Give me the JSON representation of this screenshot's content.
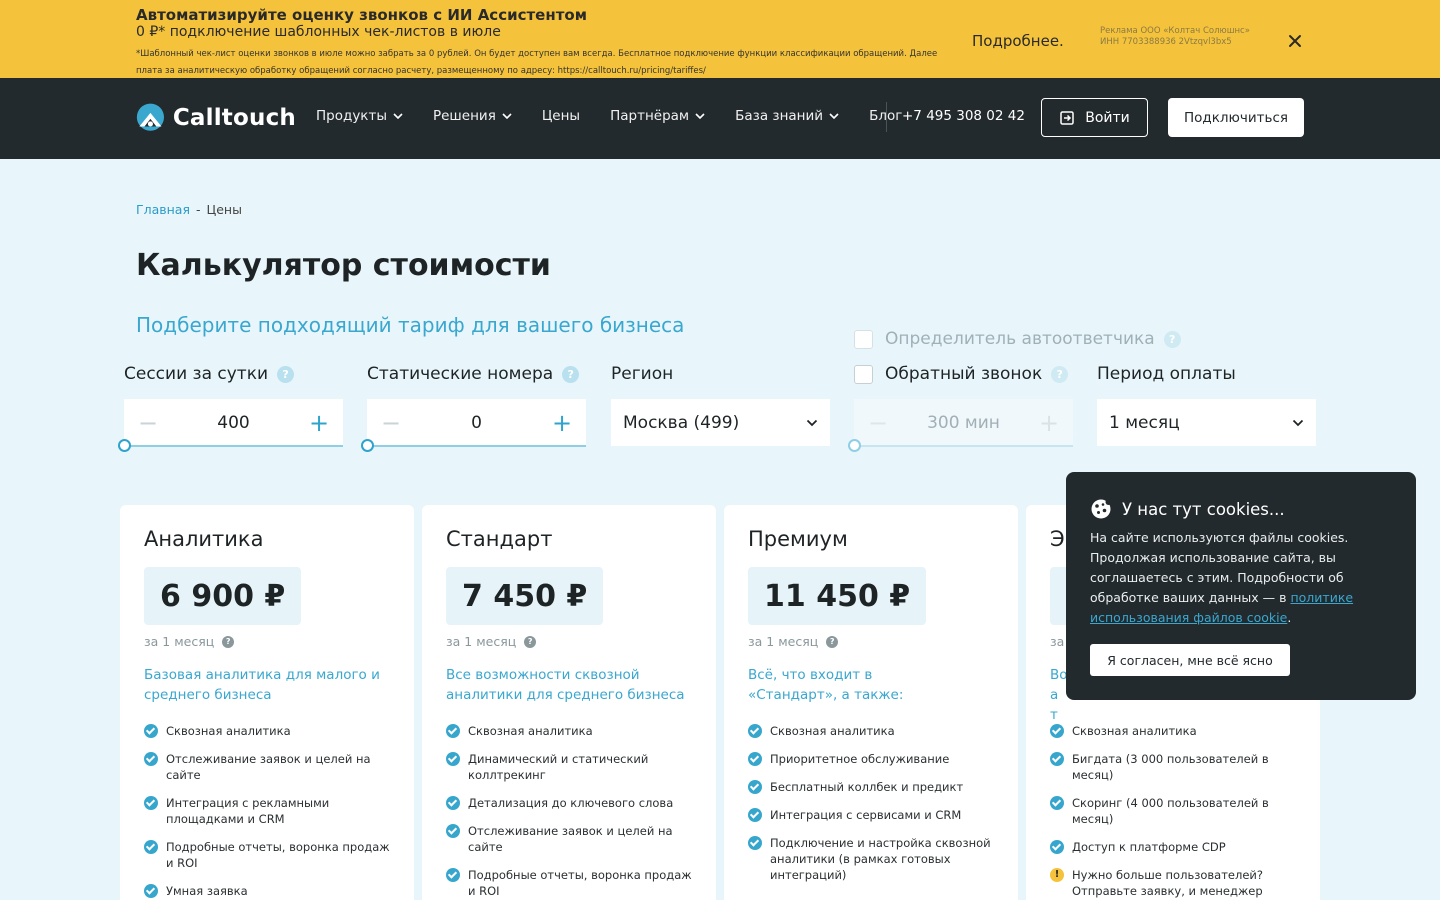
{
  "promo": {
    "title": "Автоматизируйте оценку звонков с ИИ Ассистентом",
    "subtitle": "0 ₽* подключение шаблонных чек-листов в июле",
    "note": "*Шаблонный чек-лист оценки звонков в июле можно забрать за 0 рублей. Он будет доступен вам всегда. Бесплатное подключение функции классификации обращений. Далее плата за аналитическую обработку обращений согласно расчету, размещенному по адресу: https://calltouch.ru/pricing/tariffes/",
    "more": "Подробнее.",
    "ad": "Реклама ООО «Колтач Солюшнс» ИНН 7703388936 2Vtzqvl3bx5"
  },
  "header": {
    "logo": "Calltouch",
    "nav": [
      "Продукты",
      "Решения",
      "Цены",
      "Партнёрам",
      "База знаний",
      "Блог"
    ],
    "phone": "+7 495 308 02 42",
    "login": "Войти",
    "connect": "Подключиться"
  },
  "breadcrumb": {
    "home": "Главная",
    "sep": "-",
    "current": "Цены"
  },
  "page_title": "Калькулятор стоимости",
  "subtitle": "Подберите подходящий тариф для вашего бизнеса",
  "calculator": {
    "sessions": {
      "label": "Сессии за сутки",
      "value": "400"
    },
    "static_numbers": {
      "label": "Статические номера",
      "value": "0"
    },
    "region": {
      "label": "Регион",
      "value": "Москва (499)"
    },
    "answering_machine": {
      "label": "Определитель автоответчика"
    },
    "callback": {
      "label": "Обратный звонок",
      "value": "300 мин"
    },
    "period": {
      "label": "Период оплаты",
      "value": "1 месяц"
    }
  },
  "cards": [
    {
      "name": "Аналитика",
      "price": "6 900 ₽",
      "period": "за 1 месяц",
      "desc": "Базовая аналитика для малого и среднего бизнеса",
      "features": [
        "Сквозная аналитика",
        "Отслеживание заявок и целей на сайте",
        "Интеграция с рекламными площадками и CRM",
        "Подробные отчеты, воронка продаж и ROI",
        "Умная заявка"
      ]
    },
    {
      "name": "Стандарт",
      "price": "7 450 ₽",
      "period": "за 1 месяц",
      "desc": "Все возможности сквозной аналитики для среднего бизнеса",
      "features": [
        "Сквозная аналитика",
        "Динамический и статический коллтрекинг",
        "Детализация до ключевого слова",
        "Отслеживание заявок и целей на сайте",
        "Подробные отчеты, воронка продаж и ROI"
      ]
    },
    {
      "name": "Премиум",
      "price": "11 450 ₽",
      "period": "за 1 месяц",
      "desc": "Всё, что входит в «Стандарт», а также:",
      "features": [
        "Сквозная аналитика",
        "Приоритетное обслуживание",
        "Бесплатный коллбек и предикт",
        "Интеграция с сервисами и CRM",
        "Подключение и настройка сквозной аналитики (в рамках готовых интеграций)"
      ]
    },
    {
      "name": "Э",
      "price": "",
      "period": "за",
      "desc": "Во а т",
      "features": [
        "Сквозная аналитика",
        "Бигдата (3 000 пользователей в месяц)",
        "Скоринг (4 000 пользователей в месяц)",
        "Доступ к платформе CDP"
      ],
      "warning": "Нужно больше пользователей? Отправьте заявку, и менеджер поможет с расчетом"
    }
  ],
  "cookie": {
    "title": "У нас тут cookies...",
    "text": "На сайте используются файлы cookies. Продолжая использование сайта, вы соглашаетесь с этим. Подробности об обработке ваших данных — в",
    "link": "политике использования файлов cookie",
    "dot": ".",
    "button": "Я согласен, мне всё ясно"
  }
}
